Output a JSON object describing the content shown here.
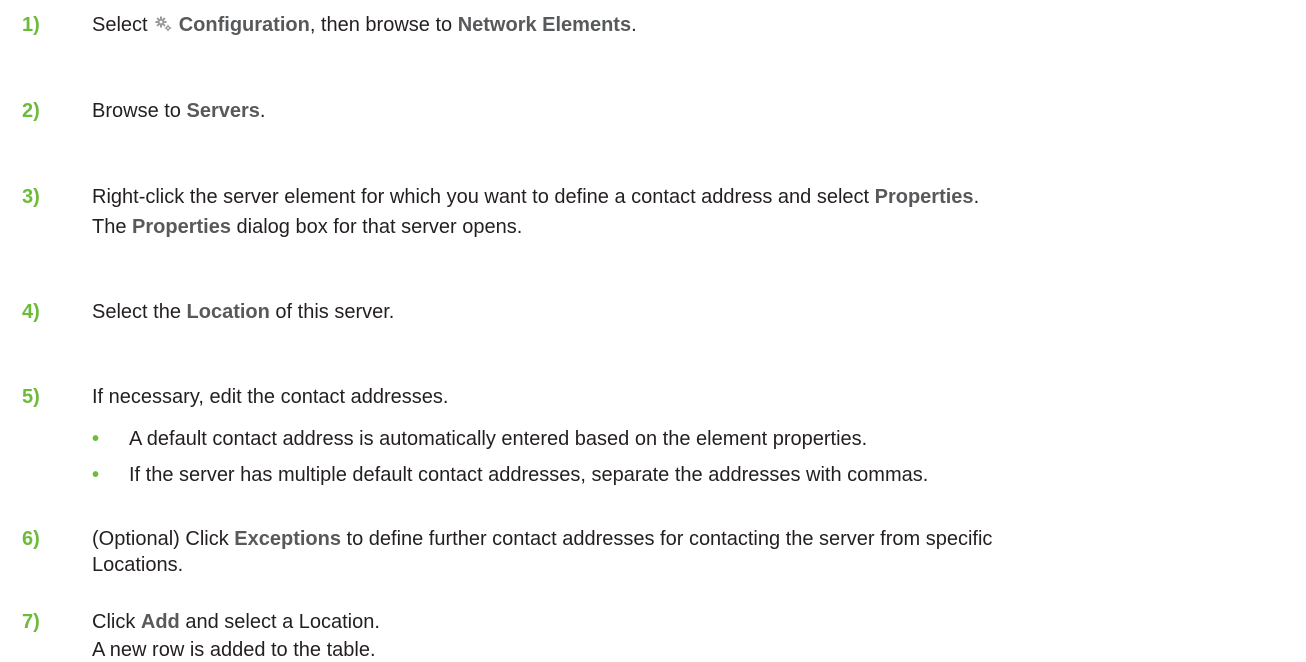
{
  "steps": [
    {
      "num": "1)",
      "parts": [
        "Select ",
        "Configuration",
        ", then browse to ",
        "Network Elements",
        "."
      ],
      "icon": "gear-icon"
    },
    {
      "num": "2)",
      "parts": [
        "Browse to ",
        "Servers",
        "."
      ]
    },
    {
      "num": "3)",
      "parts": [
        "Right-click the server element for which you want to define a contact address and select ",
        "Properties",
        "."
      ],
      "parts2": [
        "The ",
        "Properties",
        " dialog box for that server opens."
      ]
    },
    {
      "num": "4)",
      "parts": [
        "Select the ",
        "Location",
        " of this server."
      ]
    },
    {
      "num": "5)",
      "text": "If necessary, edit the contact addresses.",
      "bullets": [
        "A default contact address is automatically entered based on the element properties.",
        "If the server has multiple default contact addresses, separate the addresses with commas."
      ],
      "bullet_glyph": "•"
    },
    {
      "num": "6)",
      "parts": [
        "(Optional) Click ",
        "Exceptions",
        " to define further contact addresses for contacting the server from specific"
      ],
      "line2": "Locations."
    },
    {
      "num": "7)",
      "parts": [
        "Click ",
        "Add",
        " and select a Location."
      ],
      "line2": "A new row is added to the table."
    }
  ],
  "colors": {
    "step_number": "#6dbb3b",
    "bold_term": "#58595b",
    "body_text": "#231f20"
  }
}
